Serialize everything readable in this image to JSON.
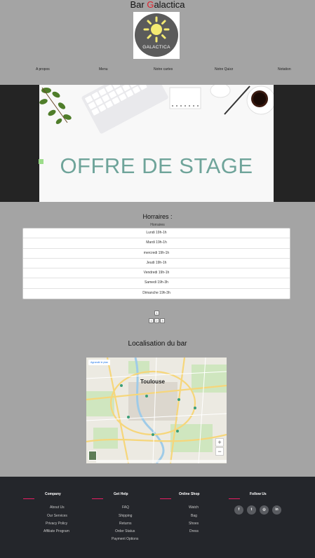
{
  "site": {
    "title_prefix": "Bar ",
    "title_accent": "G",
    "title_suffix": "alactica",
    "logo_text": "GALACTICA"
  },
  "nav": {
    "items": [
      "A propos",
      "Menu",
      "Notre cartes",
      "Notre Quizz",
      "Notation"
    ]
  },
  "hero": {
    "text": "OFFRE DE STAGE"
  },
  "hours": {
    "title": "Horraires :",
    "column": "Horraires",
    "rows": [
      "Lundi 19h-1h",
      "Mardi 19h-1h",
      "mercredi 19h-1h",
      "Jeudi 19h-1h",
      "Vendredi 19h-1h",
      "Samedi 19h-3h",
      "Dimanche 19h-3h"
    ]
  },
  "pager": {
    "top": "1",
    "bottom": [
      "1",
      "2",
      "3"
    ]
  },
  "location": {
    "title": "Localisation du bar",
    "map_button": "Agrandir le plan",
    "city": "Toulouse",
    "zoom_in": "+",
    "zoom_out": "−"
  },
  "footer": {
    "columns": [
      {
        "title": "Company",
        "links": [
          "About Us",
          "Our Services",
          "Privacy Policy",
          "Affiliate Program"
        ]
      },
      {
        "title": "Get Help",
        "links": [
          "FAQ",
          "Shipping",
          "Returns",
          "Order Status",
          "Payment Options"
        ]
      },
      {
        "title": "Online Shop",
        "links": [
          "Watch",
          "Bag",
          "Shoes",
          "Dress"
        ]
      },
      {
        "title": "Follow Us",
        "links": []
      }
    ],
    "social": [
      {
        "icon": "facebook-icon",
        "glyph": "f"
      },
      {
        "icon": "twitter-icon",
        "glyph": "t"
      },
      {
        "icon": "instagram-icon",
        "glyph": "◎"
      },
      {
        "icon": "linkedin-icon",
        "glyph": "in"
      }
    ]
  },
  "colors": {
    "page_bg": "#a4a4a4",
    "accent_red": "#e0202c",
    "hero_text": "#6fa49a",
    "footer_bg": "#24262b",
    "footer_accent": "#e91e63"
  }
}
